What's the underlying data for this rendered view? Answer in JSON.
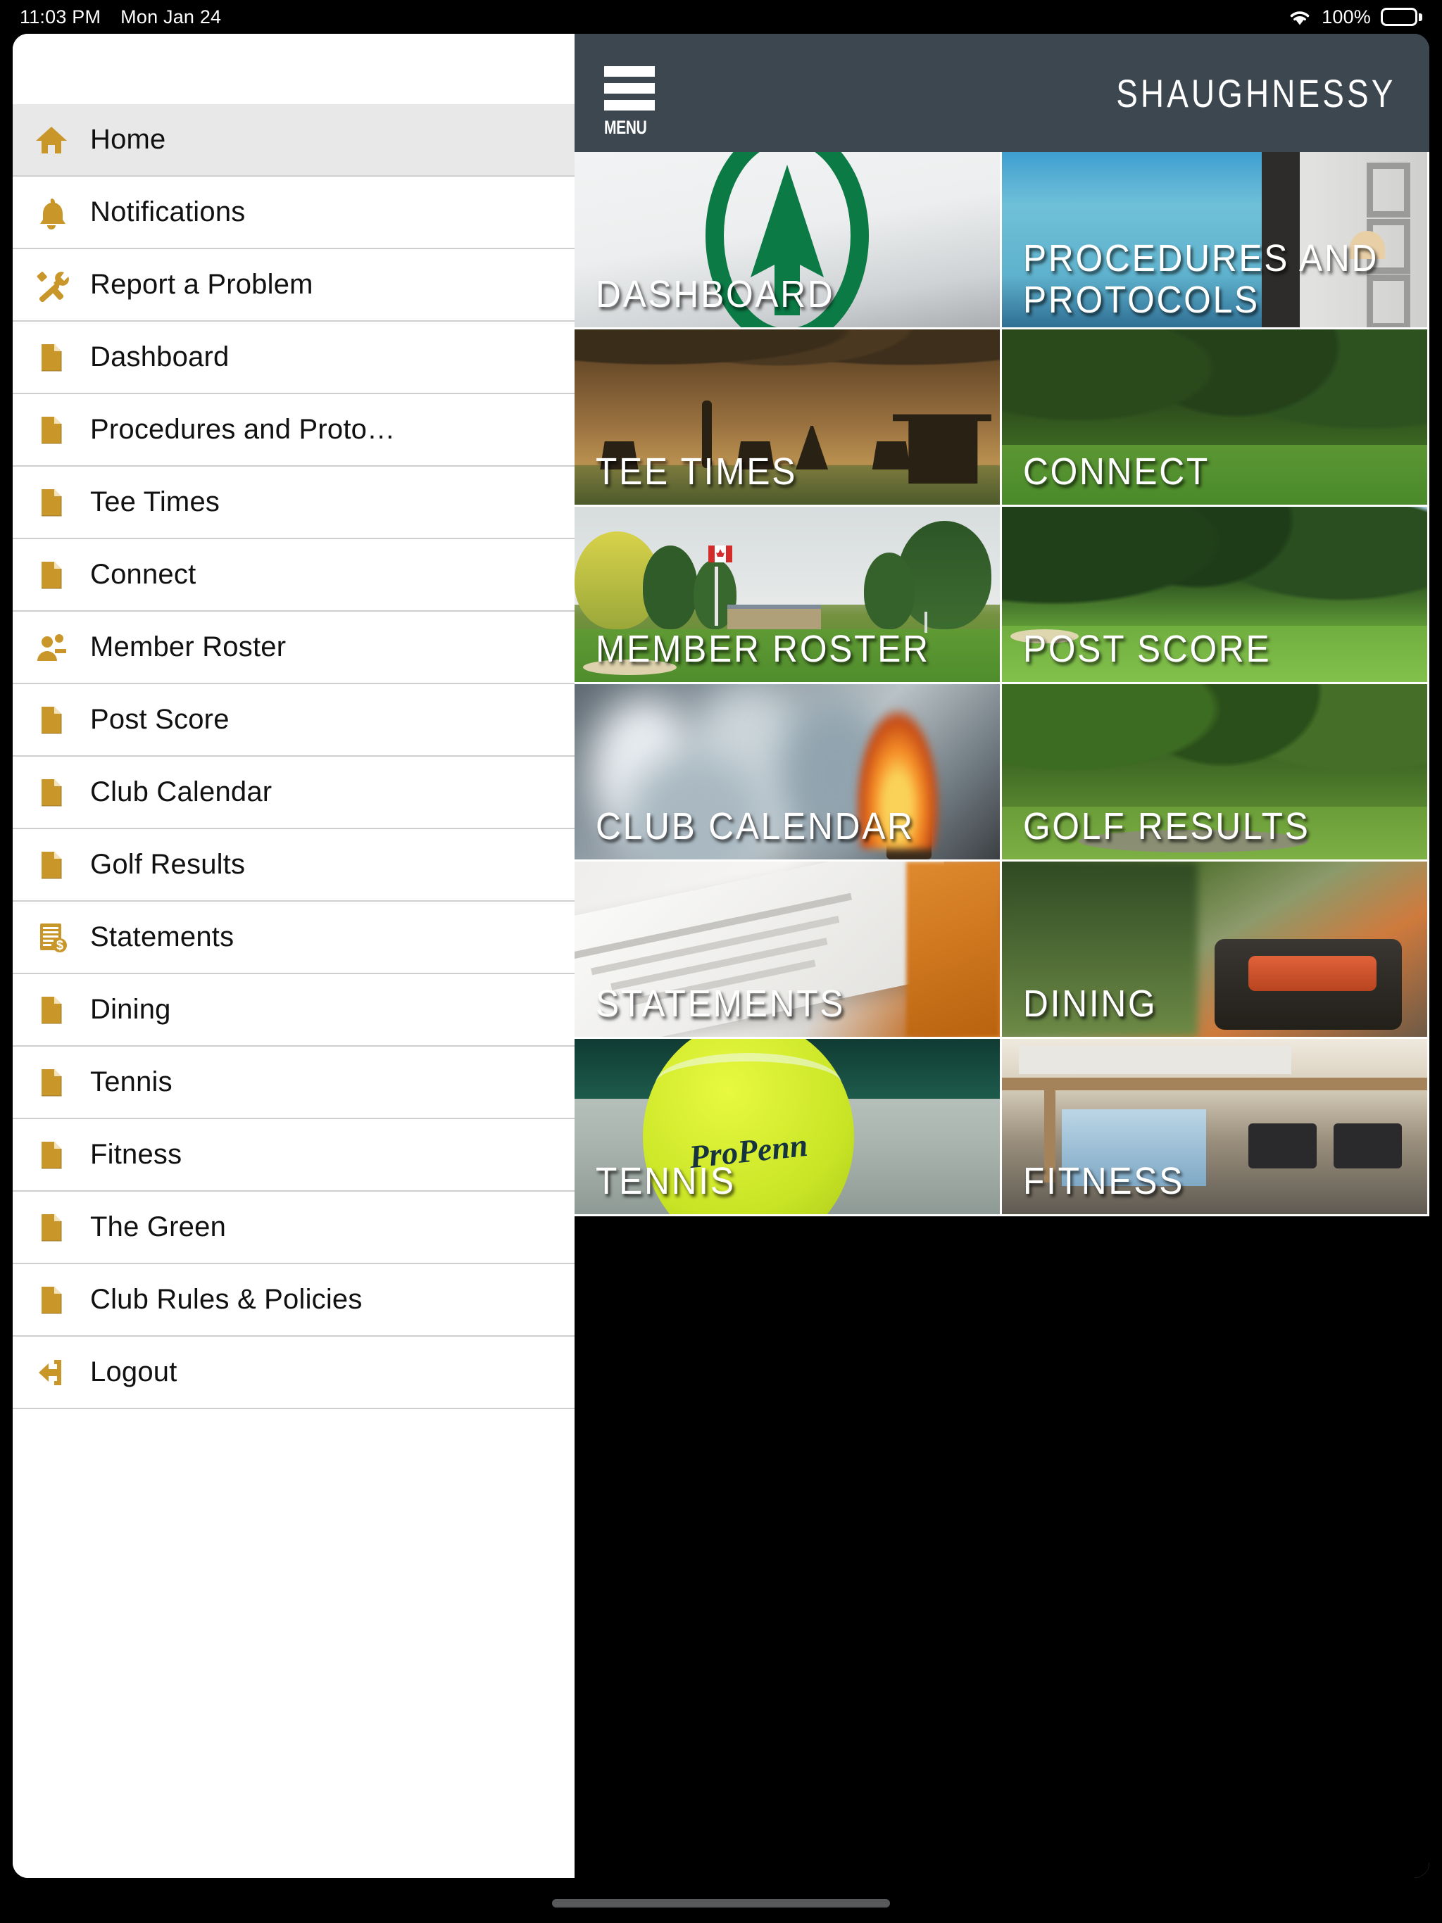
{
  "status_bar": {
    "time": "11:03 PM",
    "date": "Mon Jan 24",
    "battery_percent": "100%",
    "wifi_icon": "wifi-icon",
    "battery_icon": "battery-full-icon"
  },
  "top_bar": {
    "menu_label": "MENU",
    "menu_icon": "hamburger-menu-icon",
    "club_title": "SHAUGHNESSY"
  },
  "sidebar": {
    "items": [
      {
        "label": "Home",
        "icon": "home-icon",
        "active": true
      },
      {
        "label": "Notifications",
        "icon": "bell-icon",
        "active": false
      },
      {
        "label": "Report a Problem",
        "icon": "tools-icon",
        "active": false
      },
      {
        "label": "Dashboard",
        "icon": "document-icon",
        "active": false
      },
      {
        "label": "Procedures and Proto…",
        "icon": "document-icon",
        "active": false
      },
      {
        "label": "Tee Times",
        "icon": "document-icon",
        "active": false
      },
      {
        "label": "Connect",
        "icon": "document-icon",
        "active": false
      },
      {
        "label": "Member Roster",
        "icon": "people-icon",
        "active": false
      },
      {
        "label": "Post Score",
        "icon": "document-icon",
        "active": false
      },
      {
        "label": "Club Calendar",
        "icon": "document-icon",
        "active": false
      },
      {
        "label": "Golf Results",
        "icon": "document-icon",
        "active": false
      },
      {
        "label": "Statements",
        "icon": "invoice-dollar-icon",
        "active": false
      },
      {
        "label": "Dining",
        "icon": "document-icon",
        "active": false
      },
      {
        "label": "Tennis",
        "icon": "document-icon",
        "active": false
      },
      {
        "label": "Fitness",
        "icon": "document-icon",
        "active": false
      },
      {
        "label": "The Green",
        "icon": "document-icon",
        "active": false
      },
      {
        "label": "Club Rules & Policies",
        "icon": "document-icon",
        "active": false
      },
      {
        "label": "Logout",
        "icon": "logout-icon",
        "active": false
      }
    ]
  },
  "tiles": [
    {
      "caption": "DASHBOARD",
      "art": "dashboard"
    },
    {
      "caption": "PROCEDURES AND\nPROTOCOLS",
      "art": "proced"
    },
    {
      "caption": "TEE TIMES",
      "art": "teetimes"
    },
    {
      "caption": "CONNECT",
      "art": "connect"
    },
    {
      "caption": "MEMBER ROSTER",
      "art": "roster"
    },
    {
      "caption": "POST SCORE",
      "art": "postscore"
    },
    {
      "caption": "CLUB CALENDAR",
      "art": "calendar"
    },
    {
      "caption": "GOLF RESULTS",
      "art": "golfres"
    },
    {
      "caption": "STATEMENTS",
      "art": "statements"
    },
    {
      "caption": "DINING",
      "art": "dining"
    },
    {
      "caption": "TENNIS",
      "art": "tennis"
    },
    {
      "caption": "FITNESS",
      "art": "fitness"
    }
  ],
  "colors": {
    "sidebar_icon_gold": "#c9962a",
    "topbar_slate": "#3c4750",
    "logo_green": "#0b7a45",
    "active_row": "#e8e8e8",
    "divider": "#cfcfcf"
  }
}
